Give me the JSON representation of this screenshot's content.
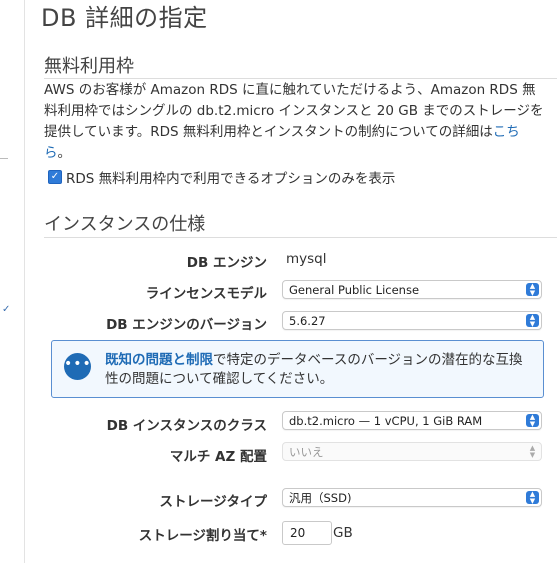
{
  "page_title": "DB 詳細の指定",
  "free_tier": {
    "title": "無料利用枠",
    "description": "AWS のお客様が Amazon RDS に直に触れていただけるよう、Amazon RDS 無料利用枠ではシングルの db.t2.micro インスタンスと 20 GB までのストレージを提供しています。RDS 無料利用枠とインスタントの制約についての詳細は",
    "link_label": "こちら",
    "description_end": "。",
    "checkbox_label": "RDS 無料利用枠内で利用できるオプションのみを表示",
    "checkbox_checked": true
  },
  "instance_spec": {
    "title": "インスタンスの仕様",
    "engine_label": "DB エンジン",
    "engine_value": "mysql",
    "license_label": "ラインセンスモデル",
    "license_value": "General Public License",
    "version_label": "DB エンジンのバージョン",
    "version_value": "5.6.27",
    "info": {
      "link1": "既知の問題",
      "and": "と",
      "link2": "制限",
      "text": "で特定のデータベースのバージョンの潜在的な互換性の問題について確認してください。"
    },
    "class_label": "DB インスタンスのクラス",
    "class_value": "db.t2.micro — 1 vCPU, 1 GiB RAM",
    "multi_az_label": "マルチ AZ 配置",
    "multi_az_value": "いいえ",
    "storage_type_label": "ストレージタイプ",
    "storage_type_value": "汎用（SSD)",
    "storage_alloc_label": "ストレージ割り当て*",
    "storage_alloc_value": "20",
    "storage_unit": "GB"
  },
  "colors": {
    "accent": "#2f7bd8",
    "link": "#1f6bb5",
    "info_border": "#5a8fd1",
    "info_bg": "#f2f8fe"
  }
}
